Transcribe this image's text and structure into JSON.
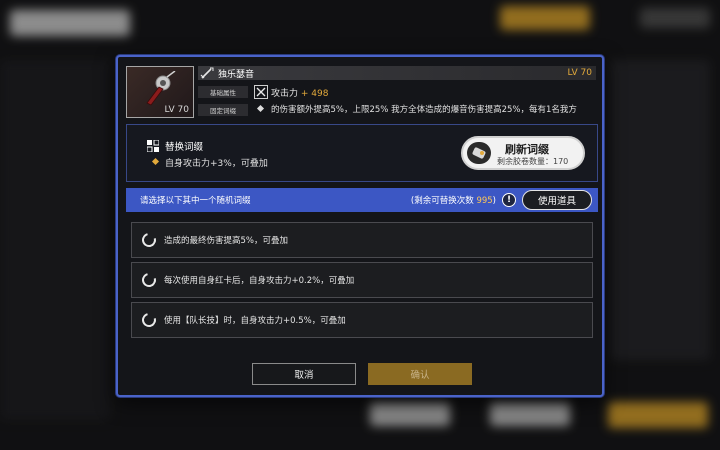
{
  "item": {
    "card_level": "LV 70",
    "name": "独乐瑟音",
    "level": "LV 70",
    "base_tag": "基础属性",
    "fixed_tag": "固定词缀",
    "attack_label": "攻击力",
    "attack_bonus": "+ 498",
    "fixed_affix": "的伤害额外提高5%，上限25%  我方全体造成的爆音伤害提高25%，每有1名我方"
  },
  "replace": {
    "title": "替换词缀",
    "affix": "自身攻击力+3%，可叠加",
    "refresh_title": "刷新词缀",
    "refresh_sub": "剩余胶卷数量：170"
  },
  "bar": {
    "prompt": "请选择以下其中一个随机词缀",
    "remaining_label": "(剩余可替换次数 ",
    "remaining_count": "995",
    "remaining_end": ")",
    "info_glyph": "!",
    "use_item": "使用道具"
  },
  "options": [
    {
      "text": "造成的最终伤害提高5%，可叠加"
    },
    {
      "text": "每次使用自身红卡后，自身攻击力+0.2%，可叠加"
    },
    {
      "text": "使用【队长技】时，自身攻击力+0.5%，可叠加"
    }
  ],
  "buttons": {
    "cancel": "取消",
    "confirm": "确认"
  },
  "colors": {
    "accent_blue": "#3c57c4",
    "gold": "#e2a93b",
    "confirm_bg": "#8a6a22"
  }
}
